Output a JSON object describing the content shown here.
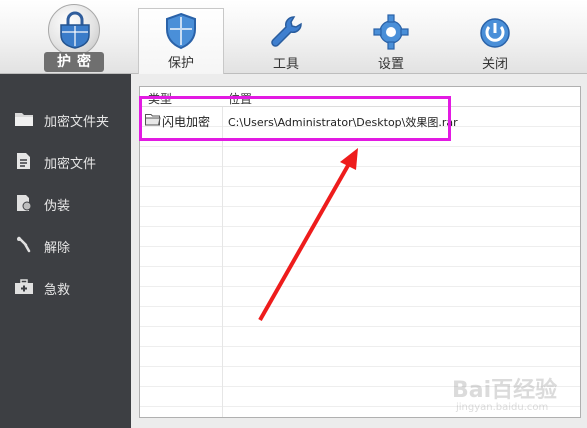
{
  "app": {
    "logo_label": "护密"
  },
  "tabs": [
    {
      "label": "保护",
      "icon": "shield-icon",
      "active": true
    },
    {
      "label": "工具",
      "icon": "wrench-icon",
      "active": false
    },
    {
      "label": "设置",
      "icon": "gear-icon",
      "active": false
    },
    {
      "label": "关闭",
      "icon": "power-icon",
      "active": false
    }
  ],
  "sidebar": {
    "items": [
      {
        "label": "加密文件夹",
        "icon": "folder-icon"
      },
      {
        "label": "加密文件",
        "icon": "file-icon"
      },
      {
        "label": "伪装",
        "icon": "disguise-icon"
      },
      {
        "label": "解除",
        "icon": "unlock-icon"
      },
      {
        "label": "急救",
        "icon": "first-aid-icon"
      }
    ]
  },
  "list": {
    "columns": [
      "类型",
      "位置"
    ],
    "rows": [
      {
        "type": "闪电加密",
        "path": "C:\\Users\\Administrator\\Desktop\\效果图.rar",
        "icon": "folder-icon"
      }
    ]
  },
  "annotation": {
    "highlight_color": "#e21ae2",
    "arrow_color": "#ee1c1c"
  },
  "watermark": {
    "text": "Bai百经验",
    "sub": "jingyan.baidu.com"
  }
}
